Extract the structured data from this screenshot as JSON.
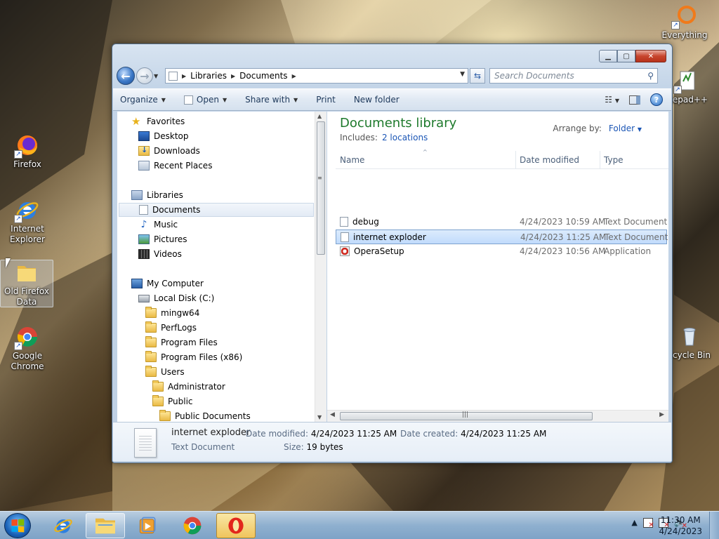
{
  "desktop": {
    "icons": [
      {
        "label": "Firefox",
        "icon": "firefox-icon"
      },
      {
        "label": "Internet Explorer",
        "icon": "ie-icon"
      },
      {
        "label": "Old Firefox Data",
        "icon": "folder-icon"
      },
      {
        "label": "Google Chrome",
        "icon": "chrome-icon"
      },
      {
        "label": "Everything",
        "icon": "everything-icon"
      },
      {
        "label": "tepad++",
        "icon": "notepadpp-icon"
      },
      {
        "label": "cycle Bin",
        "icon": "recycle-bin-icon"
      }
    ]
  },
  "window": {
    "address": {
      "crumbs": [
        "Libraries",
        "Documents"
      ]
    },
    "search": {
      "placeholder": "Search Documents"
    },
    "toolbar": {
      "organize": "Organize",
      "open": "Open",
      "share_with": "Share with",
      "print": "Print",
      "new_folder": "New folder"
    },
    "nav": {
      "favorites": "Favorites",
      "desktop": "Desktop",
      "downloads": "Downloads",
      "recent": "Recent Places",
      "libraries": "Libraries",
      "documents": "Documents",
      "music": "Music",
      "pictures": "Pictures",
      "videos": "Videos",
      "computer": "My Computer",
      "local_disk": "Local Disk (C:)",
      "folders": [
        "mingw64",
        "PerfLogs",
        "Program Files",
        "Program Files (x86)",
        "Users"
      ],
      "administrator": "Administrator",
      "public": "Public",
      "public_documents": "Public Documents"
    },
    "main": {
      "title": "Documents library",
      "includes_label": "Includes:",
      "includes_link": "2 locations",
      "arrange_label": "Arrange by:",
      "arrange_value": "Folder",
      "columns": {
        "name": "Name",
        "date": "Date modified",
        "type": "Type"
      },
      "files": [
        {
          "name": "debug",
          "date": "4/24/2023 10:59 AM",
          "type": "Text Document",
          "selected": false
        },
        {
          "name": "internet exploder",
          "date": "4/24/2023 11:25 AM",
          "type": "Text Document",
          "selected": true
        },
        {
          "name": "OperaSetup",
          "date": "4/24/2023 10:56 AM",
          "type": "Application",
          "selected": false
        }
      ]
    },
    "details": {
      "name": "internet exploder",
      "kind": "Text Document",
      "modified_label": "Date modified:",
      "modified_value": "4/24/2023 11:25 AM",
      "created_label": "Date created:",
      "created_value": "4/24/2023 11:25 AM",
      "size_label": "Size:",
      "size_value": "19 bytes"
    }
  },
  "taskbar": {
    "clock_time": "11:30 AM",
    "clock_date": "4/24/2023"
  },
  "colors": {
    "library_title": "#1e7a2c",
    "link": "#1a55b5",
    "selection": "#c1dbfc"
  }
}
